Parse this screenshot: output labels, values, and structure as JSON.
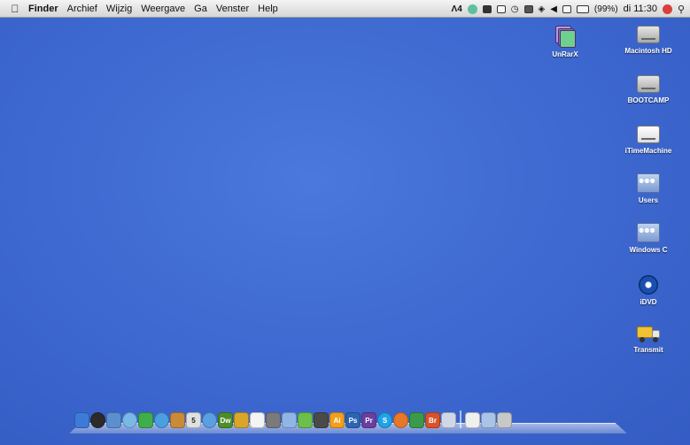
{
  "menubar": {
    "app_name": "Finder",
    "menus": [
      "Archief",
      "Wijzig",
      "Weergave",
      "Ga",
      "Venster",
      "Help"
    ],
    "status": {
      "adobe_count": "4",
      "battery": "(99%)",
      "clock": "di 11:30"
    },
    "icons": [
      "apple-icon",
      "adobe-updates-icon",
      "sync-icon",
      "display-icon",
      "grid-icon",
      "time-machine-icon",
      "screen-icon",
      "wifi-icon",
      "volume-icon",
      "input-icon",
      "battery-icon",
      "user-icon",
      "spotlight-icon"
    ]
  },
  "desktop": {
    "background_color": "#3f6ad0",
    "icons": [
      {
        "label": "UnRarX",
        "icon": "unrarx-app-icon"
      },
      {
        "label": "Macintosh HD",
        "icon": "hard-drive-icon"
      },
      {
        "label": "BOOTCAMP",
        "icon": "hard-drive-icon"
      },
      {
        "label": "iTimeMachine",
        "icon": "external-drive-icon"
      },
      {
        "label": "Users",
        "icon": "network-share-icon"
      },
      {
        "label": "Windows C",
        "icon": "network-share-icon"
      },
      {
        "label": "iDVD",
        "icon": "idvd-icon"
      },
      {
        "label": "Transmit",
        "icon": "transmit-icon"
      }
    ]
  },
  "dock": {
    "items": [
      {
        "icon": "finder-icon",
        "text": "",
        "color": "#3d7bd9"
      },
      {
        "icon": "dashboard-icon",
        "text": "",
        "color": "#2b2b2b"
      },
      {
        "icon": "mail-icon",
        "text": "",
        "color": "#5b8fd0"
      },
      {
        "icon": "ichat-icon",
        "text": "",
        "color": "#7ab8e8"
      },
      {
        "icon": "messenger-icon",
        "text": "",
        "color": "#3fae4a"
      },
      {
        "icon": "safari-icon",
        "text": "",
        "color": "#4a9fe0"
      },
      {
        "icon": "address-book-icon",
        "text": "",
        "color": "#c98a3a"
      },
      {
        "icon": "ical-icon",
        "text": "5",
        "color": "#e0e0e0"
      },
      {
        "icon": "itunes-icon",
        "text": "",
        "color": "#5aa0e0"
      },
      {
        "icon": "dreamweaver-icon",
        "text": "Dw",
        "color": "#4e8c2a"
      },
      {
        "icon": "transmit-dock-icon",
        "text": "",
        "color": "#d9a629"
      },
      {
        "icon": "textedit-icon",
        "text": "",
        "color": "#f4f4f4"
      },
      {
        "icon": "photo-booth-icon",
        "text": "",
        "color": "#7a7a7a"
      },
      {
        "icon": "iphoto-icon",
        "text": "",
        "color": "#8fb6e6"
      },
      {
        "icon": "coda-icon",
        "text": "",
        "color": "#6cbf4a"
      },
      {
        "icon": "final-cut-icon",
        "text": "",
        "color": "#4a4a4a"
      },
      {
        "icon": "illustrator-icon",
        "text": "Ai",
        "color": "#f29f1d"
      },
      {
        "icon": "photoshop-icon",
        "text": "Ps",
        "color": "#2d64b3"
      },
      {
        "icon": "premiere-icon",
        "text": "Pr",
        "color": "#6a3fa0"
      },
      {
        "icon": "skype-icon",
        "text": "S",
        "color": "#1fa3e8"
      },
      {
        "icon": "firefox-icon",
        "text": "",
        "color": "#e8772a"
      },
      {
        "icon": "camino-icon",
        "text": "",
        "color": "#3a9a4a"
      },
      {
        "icon": "bridge-icon",
        "text": "Br",
        "color": "#d8532a"
      },
      {
        "icon": "image-capture-icon",
        "text": "",
        "color": "#d0d8e8"
      }
    ],
    "right_items": [
      {
        "icon": "documents-stack-icon",
        "text": "",
        "color": "#f0f0f0"
      },
      {
        "icon": "downloads-stack-icon",
        "text": "",
        "color": "#a9c4e8"
      },
      {
        "icon": "trash-icon",
        "text": "",
        "color": "#c8c8c8"
      }
    ]
  }
}
